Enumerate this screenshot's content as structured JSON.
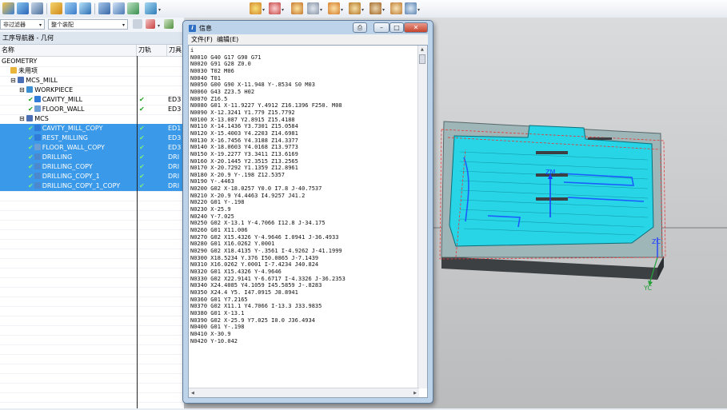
{
  "navigator": {
    "filter_combo": "非过滤器",
    "assembly_combo": "整个装配",
    "title": "工序导航器 - 几何",
    "columns": {
      "name": "名称",
      "path": "刀轨",
      "tool": "刀具"
    },
    "rows": [
      {
        "label": "GEOMETRY",
        "indent": 0,
        "icon": "",
        "check": "",
        "tool": "",
        "selected": false
      },
      {
        "label": "未用项",
        "indent": 1,
        "icon": "folder",
        "check": "",
        "tool": "",
        "selected": false
      },
      {
        "label": "MCS_MILL",
        "indent": 1,
        "icon": "mcs",
        "check": "",
        "tool": "",
        "selected": false
      },
      {
        "label": "WORKPIECE",
        "indent": 2,
        "icon": "workpiece",
        "check": "",
        "tool": "",
        "selected": false
      },
      {
        "label": "CAVITY_MILL",
        "indent": 3,
        "icon": "cavity",
        "check": "✔",
        "tool": "ED3",
        "selected": false
      },
      {
        "label": "FLOOR_WALL",
        "indent": 3,
        "icon": "floor",
        "check": "✔",
        "tool": "ED3",
        "selected": false
      },
      {
        "label": "MCS",
        "indent": 2,
        "icon": "mcs",
        "check": "",
        "tool": "",
        "selected": false
      },
      {
        "label": "CAVITY_MILL_COPY",
        "indent": 3,
        "icon": "cavity",
        "check": "✔",
        "tool": "ED1",
        "selected": true
      },
      {
        "label": "REST_MILLING",
        "indent": 3,
        "icon": "cavity",
        "check": "✔",
        "tool": "ED3",
        "selected": true
      },
      {
        "label": "FLOOR_WALL_COPY",
        "indent": 3,
        "icon": "floor",
        "check": "✔",
        "tool": "ED3",
        "selected": true
      },
      {
        "label": "DRILLING",
        "indent": 3,
        "icon": "drill",
        "check": "✔",
        "tool": "DRI",
        "selected": true
      },
      {
        "label": "DRILLING_COPY",
        "indent": 3,
        "icon": "drill",
        "check": "✔",
        "tool": "DRI",
        "selected": true
      },
      {
        "label": "DRILLING_COPY_1",
        "indent": 3,
        "icon": "drill",
        "check": "✔",
        "tool": "DRI",
        "selected": true
      },
      {
        "label": "DRILLING_COPY_1_COPY",
        "indent": 3,
        "icon": "drill",
        "check": "✔",
        "tool": "DRI",
        "selected": true
      }
    ]
  },
  "info_window": {
    "title": "信息",
    "menu": [
      "文件(F)",
      "编辑(E)"
    ],
    "cursor": "i",
    "lines": [
      "N0010 G40 G17 G90 G71",
      "N0020 G91 G28 Z0.0",
      "N0030 T02 M06",
      "N0040 T01",
      "N0050 G00 G90 X-11.948 Y-.8534 S0 M03",
      "N0060 G43 Z23.5 H02",
      "N0070 Z16.5",
      "N0080 G01 X-11.9227 Y.4912 Z16.1396 F250. M08",
      "N0090 X-12.3241 Y1.779 Z15.7792",
      "N0100 X-13.087 Y2.8915 Z15.4188",
      "N0110 X-14.1436 Y3.7301 Z15.0584",
      "N0120 X-15.4003 Y4.2203 Z14.6981",
      "N0130 X-16.7456 Y4.3188 Z14.3377",
      "N0140 X-18.0603 Y4.0168 Z13.9773",
      "N0150 X-19.2277 Y3.3411 Z13.6169",
      "N0160 X-20.1445 Y2.3515 Z13.2565",
      "N0170 X-20.7292 Y1.1359 Z12.8961",
      "N0180 X-20.9 Y-.198 Z12.5357",
      "N0190 Y-.4463",
      "N0200 G02 X-18.0257 Y0.0 I7.8 J-40.7537",
      "N0210 X-20.9 Y4.4463 I4.9257 J41.2",
      "N0220 G01 Y-.198",
      "N0230 X-25.9",
      "N0240 Y-7.025",
      "N0250 G02 X-13.1 Y-4.7066 I12.8 J-34.175",
      "N0260 G01 X11.006",
      "N0270 G02 X15.4326 Y-4.9646 I.0941 J-36.4933",
      "N0280 G01 X16.0262 Y.0001",
      "N0290 G02 X18.4135 Y-.3561 I-4.9262 J-41.1999",
      "N0300 X18.5234 Y.376 I50.0865 J-7.1439",
      "N0310 X16.0262 Y.0001 I-7.4234 J40.824",
      "N0320 G01 X15.4326 Y-4.9646",
      "N0330 G02 X22.9141 Y-6.6717 I-4.3326 J-36.2353",
      "N0340 X24.4085 Y4.1059 I45.5859 J-.8283",
      "N0350 X24.4 Y5. I47.0915 J8.8941",
      "N0360 G01 Y7.2165",
      "N0370 G02 X11.1 Y4.7066 I-13.3 J33.9835",
      "N0380 G01 X-13.1",
      "N0390 G02 X-25.9 Y7.025 I0.0 J36.4934",
      "N0400 G01 Y-.198",
      "N0410 X-30.9",
      "N0420 Y-10.042"
    ]
  },
  "viewport": {
    "axis_zm": "ZM",
    "axis_zc": "ZC",
    "axis_yc": "YC",
    "accent_colors": {
      "toolpath": "#22d4e8",
      "feed": "#1a5cff",
      "rapid": "#e03a3a",
      "selection": "#3a99e8"
    }
  }
}
